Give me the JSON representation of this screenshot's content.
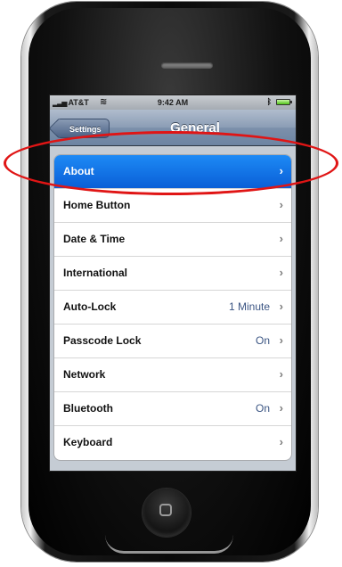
{
  "status_bar": {
    "carrier": "AT&T",
    "signal": "▂▃▅",
    "wifi_glyph": "≋",
    "time": "9:42 AM",
    "bluetooth_glyph": "ᛒ"
  },
  "nav": {
    "back_label": "Settings",
    "title": "General"
  },
  "rows": [
    {
      "label": "About",
      "value": "",
      "selected": true
    },
    {
      "label": "Home Button",
      "value": ""
    },
    {
      "label": "Date & Time",
      "value": ""
    },
    {
      "label": "International",
      "value": ""
    },
    {
      "label": "Auto-Lock",
      "value": "1 Minute"
    },
    {
      "label": "Passcode Lock",
      "value": "On"
    },
    {
      "label": "Network",
      "value": ""
    },
    {
      "label": "Bluetooth",
      "value": "On"
    },
    {
      "label": "Keyboard",
      "value": ""
    }
  ],
  "chevron_glyph": "›",
  "colors": {
    "selection": "#0a6fe6",
    "annotation": "#e01515",
    "value_text": "#3b5583"
  }
}
